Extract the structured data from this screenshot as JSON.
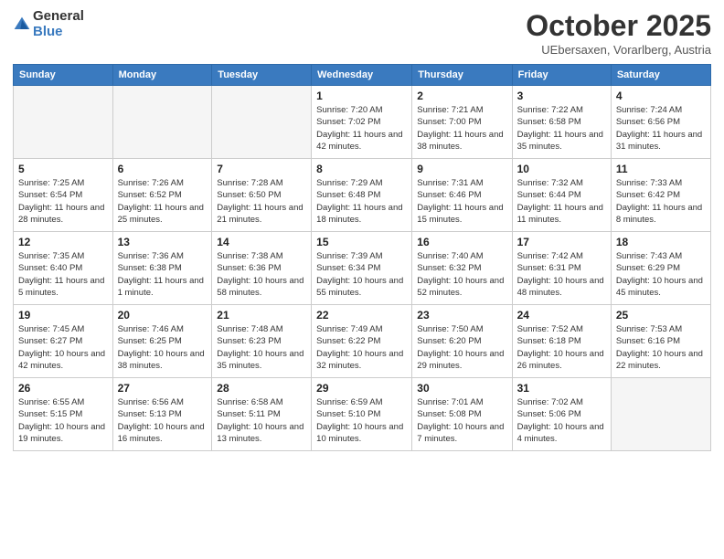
{
  "header": {
    "logo": {
      "general": "General",
      "blue": "Blue"
    },
    "title": "October 2025",
    "subtitle": "UEbersaxen, Vorarlberg, Austria"
  },
  "weekdays": [
    "Sunday",
    "Monday",
    "Tuesday",
    "Wednesday",
    "Thursday",
    "Friday",
    "Saturday"
  ],
  "weeks": [
    [
      {
        "day": "",
        "info": ""
      },
      {
        "day": "",
        "info": ""
      },
      {
        "day": "",
        "info": ""
      },
      {
        "day": "1",
        "info": "Sunrise: 7:20 AM\nSunset: 7:02 PM\nDaylight: 11 hours and 42 minutes."
      },
      {
        "day": "2",
        "info": "Sunrise: 7:21 AM\nSunset: 7:00 PM\nDaylight: 11 hours and 38 minutes."
      },
      {
        "day": "3",
        "info": "Sunrise: 7:22 AM\nSunset: 6:58 PM\nDaylight: 11 hours and 35 minutes."
      },
      {
        "day": "4",
        "info": "Sunrise: 7:24 AM\nSunset: 6:56 PM\nDaylight: 11 hours and 31 minutes."
      }
    ],
    [
      {
        "day": "5",
        "info": "Sunrise: 7:25 AM\nSunset: 6:54 PM\nDaylight: 11 hours and 28 minutes."
      },
      {
        "day": "6",
        "info": "Sunrise: 7:26 AM\nSunset: 6:52 PM\nDaylight: 11 hours and 25 minutes."
      },
      {
        "day": "7",
        "info": "Sunrise: 7:28 AM\nSunset: 6:50 PM\nDaylight: 11 hours and 21 minutes."
      },
      {
        "day": "8",
        "info": "Sunrise: 7:29 AM\nSunset: 6:48 PM\nDaylight: 11 hours and 18 minutes."
      },
      {
        "day": "9",
        "info": "Sunrise: 7:31 AM\nSunset: 6:46 PM\nDaylight: 11 hours and 15 minutes."
      },
      {
        "day": "10",
        "info": "Sunrise: 7:32 AM\nSunset: 6:44 PM\nDaylight: 11 hours and 11 minutes."
      },
      {
        "day": "11",
        "info": "Sunrise: 7:33 AM\nSunset: 6:42 PM\nDaylight: 11 hours and 8 minutes."
      }
    ],
    [
      {
        "day": "12",
        "info": "Sunrise: 7:35 AM\nSunset: 6:40 PM\nDaylight: 11 hours and 5 minutes."
      },
      {
        "day": "13",
        "info": "Sunrise: 7:36 AM\nSunset: 6:38 PM\nDaylight: 11 hours and 1 minute."
      },
      {
        "day": "14",
        "info": "Sunrise: 7:38 AM\nSunset: 6:36 PM\nDaylight: 10 hours and 58 minutes."
      },
      {
        "day": "15",
        "info": "Sunrise: 7:39 AM\nSunset: 6:34 PM\nDaylight: 10 hours and 55 minutes."
      },
      {
        "day": "16",
        "info": "Sunrise: 7:40 AM\nSunset: 6:32 PM\nDaylight: 10 hours and 52 minutes."
      },
      {
        "day": "17",
        "info": "Sunrise: 7:42 AM\nSunset: 6:31 PM\nDaylight: 10 hours and 48 minutes."
      },
      {
        "day": "18",
        "info": "Sunrise: 7:43 AM\nSunset: 6:29 PM\nDaylight: 10 hours and 45 minutes."
      }
    ],
    [
      {
        "day": "19",
        "info": "Sunrise: 7:45 AM\nSunset: 6:27 PM\nDaylight: 10 hours and 42 minutes."
      },
      {
        "day": "20",
        "info": "Sunrise: 7:46 AM\nSunset: 6:25 PM\nDaylight: 10 hours and 38 minutes."
      },
      {
        "day": "21",
        "info": "Sunrise: 7:48 AM\nSunset: 6:23 PM\nDaylight: 10 hours and 35 minutes."
      },
      {
        "day": "22",
        "info": "Sunrise: 7:49 AM\nSunset: 6:22 PM\nDaylight: 10 hours and 32 minutes."
      },
      {
        "day": "23",
        "info": "Sunrise: 7:50 AM\nSunset: 6:20 PM\nDaylight: 10 hours and 29 minutes."
      },
      {
        "day": "24",
        "info": "Sunrise: 7:52 AM\nSunset: 6:18 PM\nDaylight: 10 hours and 26 minutes."
      },
      {
        "day": "25",
        "info": "Sunrise: 7:53 AM\nSunset: 6:16 PM\nDaylight: 10 hours and 22 minutes."
      }
    ],
    [
      {
        "day": "26",
        "info": "Sunrise: 6:55 AM\nSunset: 5:15 PM\nDaylight: 10 hours and 19 minutes."
      },
      {
        "day": "27",
        "info": "Sunrise: 6:56 AM\nSunset: 5:13 PM\nDaylight: 10 hours and 16 minutes."
      },
      {
        "day": "28",
        "info": "Sunrise: 6:58 AM\nSunset: 5:11 PM\nDaylight: 10 hours and 13 minutes."
      },
      {
        "day": "29",
        "info": "Sunrise: 6:59 AM\nSunset: 5:10 PM\nDaylight: 10 hours and 10 minutes."
      },
      {
        "day": "30",
        "info": "Sunrise: 7:01 AM\nSunset: 5:08 PM\nDaylight: 10 hours and 7 minutes."
      },
      {
        "day": "31",
        "info": "Sunrise: 7:02 AM\nSunset: 5:06 PM\nDaylight: 10 hours and 4 minutes."
      },
      {
        "day": "",
        "info": ""
      }
    ]
  ]
}
